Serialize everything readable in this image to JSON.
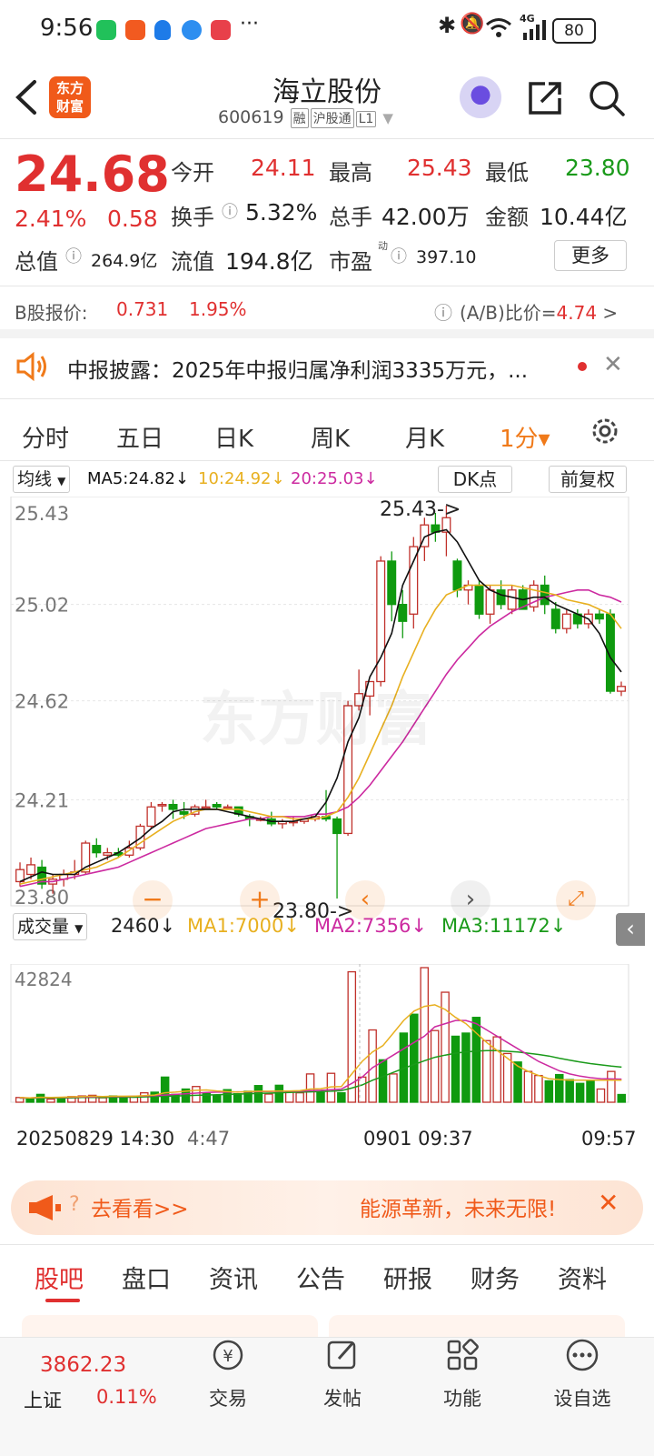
{
  "status_bar": {
    "time": "9:56",
    "network": "4G",
    "battery": "80"
  },
  "header": {
    "logo_text": "东方\n财富",
    "title": "海立股份",
    "code": "600619",
    "tags": [
      "融",
      "沪股通",
      "L1"
    ]
  },
  "quote": {
    "price": "24.68",
    "change_pct": "2.41%",
    "change": "0.58",
    "open_label": "今开",
    "open": "24.11",
    "high_label": "最高",
    "high": "25.43",
    "low_label": "最低",
    "low": "23.80",
    "turnover_label": "换手",
    "turnover": "5.32%",
    "volume_label": "总手",
    "volume": "42.00万",
    "amount_label": "金额",
    "amount": "10.44亿",
    "mcap_label": "总值",
    "mcap": "264.9亿",
    "float_label": "流值",
    "float": "194.8亿",
    "pe_label": "市盈",
    "pe_sup": "动",
    "pe": "397.10",
    "more_button": "更多",
    "b_share_label": "B股报价:",
    "b_share_price": "0.731",
    "b_share_pct": "1.95%",
    "ab_ratio_label": "(A/B)比价=",
    "ab_ratio": "4.74",
    "ab_arrow": ">"
  },
  "notice": {
    "text": "中报披露：2025年中报归属净利润3335万元，..."
  },
  "chart_tabs": [
    "分时",
    "五日",
    "日K",
    "周K",
    "月K",
    "1分▾"
  ],
  "chart_controls": {
    "indicator": "均线",
    "ma5": "MA5:24.82↓",
    "ma10": "10:24.92↓",
    "ma20": "20:25.03↓",
    "dk": "DK点",
    "adjust": "前复权"
  },
  "volume_controls": {
    "indicator": "成交量",
    "vol": "2460↓",
    "ma1": "MA1:7000↓",
    "ma2": "MA2:7356↓",
    "ma3": "MA3:11172↓"
  },
  "annotations": {
    "high": "25.43->",
    "low": "23.80->"
  },
  "watermark": "东方财富",
  "x_labels": [
    "20250829 14:30",
    "4:47",
    "0901 09:37",
    "09:57"
  ],
  "promo": {
    "left": "去看看>>",
    "right": "能源革新，未来无限!"
  },
  "bottom_tabs": [
    "股吧",
    "盘口",
    "资讯",
    "公告",
    "研报",
    "财务",
    "资料"
  ],
  "bottom_nav": {
    "index_value": "3862.23",
    "index_name": "上证",
    "index_pct": "0.11%",
    "items": [
      "交易",
      "发帖",
      "功能",
      "设自选"
    ]
  },
  "colors": {
    "up": "#e03030",
    "down": "#1a9a1a",
    "accent": "#f07a1a",
    "ma5": "#111111",
    "ma10": "#e8b020",
    "ma20": "#cc2aa0"
  },
  "chart_data": [
    {
      "type": "candlestick",
      "title": "",
      "ylim": [
        23.8,
        25.43
      ],
      "y_ticks": [
        "25.43",
        "25.02",
        "24.62",
        "24.21",
        "23.80"
      ],
      "x_ticks": [
        "20250829 14:30",
        "4:47",
        "0901 09:37",
        "09:57"
      ],
      "ohlc": [
        [
          23.87,
          23.95,
          23.85,
          23.92
        ],
        [
          23.9,
          23.97,
          23.88,
          23.94
        ],
        [
          23.93,
          23.96,
          23.84,
          23.86
        ],
        [
          23.86,
          23.9,
          23.82,
          23.88
        ],
        [
          23.88,
          23.92,
          23.85,
          23.9
        ],
        [
          23.9,
          23.96,
          23.88,
          23.91
        ],
        [
          23.91,
          24.04,
          23.9,
          24.03
        ],
        [
          24.02,
          24.05,
          23.97,
          23.99
        ],
        [
          23.98,
          24.01,
          23.96,
          23.99
        ],
        [
          23.99,
          24.01,
          23.97,
          23.98
        ],
        [
          23.98,
          24.04,
          23.97,
          24.01
        ],
        [
          24.01,
          24.11,
          24.0,
          24.1
        ],
        [
          24.1,
          24.2,
          24.09,
          24.18
        ],
        [
          24.19,
          24.2,
          24.16,
          24.19
        ],
        [
          24.19,
          24.21,
          24.13,
          24.17
        ],
        [
          24.16,
          24.2,
          24.13,
          24.15
        ],
        [
          24.15,
          24.19,
          24.14,
          24.18
        ],
        [
          24.18,
          24.21,
          24.17,
          24.18
        ],
        [
          24.19,
          24.2,
          24.17,
          24.18
        ],
        [
          24.18,
          24.19,
          24.17,
          24.18
        ],
        [
          24.18,
          24.18,
          24.14,
          24.15
        ],
        [
          24.14,
          24.15,
          24.1,
          24.13
        ],
        [
          24.13,
          24.14,
          24.12,
          24.13
        ],
        [
          24.13,
          24.16,
          24.1,
          24.11
        ],
        [
          24.11,
          24.13,
          24.09,
          24.12
        ],
        [
          24.12,
          24.14,
          24.1,
          24.12
        ],
        [
          24.12,
          24.13,
          24.11,
          24.13
        ],
        [
          24.13,
          24.14,
          24.12,
          24.14
        ],
        [
          24.14,
          24.25,
          24.12,
          24.13
        ],
        [
          24.13,
          24.14,
          23.8,
          24.07
        ],
        [
          24.07,
          24.62,
          24.06,
          24.6
        ],
        [
          24.6,
          24.75,
          24.58,
          24.65
        ],
        [
          24.64,
          24.7,
          24.56,
          24.7
        ],
        [
          24.7,
          25.22,
          24.68,
          25.2
        ],
        [
          25.2,
          25.24,
          24.95,
          25.02
        ],
        [
          25.02,
          25.08,
          24.88,
          24.95
        ],
        [
          24.98,
          25.3,
          24.92,
          25.26
        ],
        [
          25.26,
          25.38,
          25.2,
          25.35
        ],
        [
          25.35,
          25.4,
          25.28,
          25.32
        ],
        [
          25.32,
          25.43,
          25.22,
          25.38
        ],
        [
          25.2,
          25.21,
          25.05,
          25.08
        ],
        [
          25.08,
          25.12,
          25.02,
          25.1
        ],
        [
          25.1,
          25.12,
          24.96,
          24.98
        ],
        [
          24.98,
          25.1,
          24.94,
          25.08
        ],
        [
          25.08,
          25.12,
          25.0,
          25.02
        ],
        [
          25.0,
          25.1,
          24.98,
          25.08
        ],
        [
          25.08,
          25.1,
          25.0,
          25.0
        ],
        [
          25.01,
          25.12,
          24.99,
          25.1
        ],
        [
          25.1,
          25.14,
          24.98,
          25.02
        ],
        [
          25.0,
          25.03,
          24.9,
          24.92
        ],
        [
          24.92,
          25.0,
          24.9,
          24.98
        ],
        [
          24.98,
          25.0,
          24.92,
          24.94
        ],
        [
          24.94,
          25.0,
          24.92,
          24.98
        ],
        [
          24.98,
          25.0,
          24.94,
          24.96
        ],
        [
          24.98,
          25.0,
          24.65,
          24.66
        ],
        [
          24.66,
          24.7,
          24.64,
          24.68
        ]
      ],
      "ma5": [
        23.87,
        23.89,
        23.91,
        23.9,
        23.9,
        23.9,
        23.93,
        23.95,
        23.97,
        23.99,
        24.02,
        24.05,
        24.09,
        24.12,
        24.16,
        24.17,
        24.17,
        24.17,
        24.17,
        24.16,
        24.15,
        24.14,
        24.13,
        24.12,
        24.12,
        24.12,
        24.13,
        24.14,
        24.2,
        24.3,
        24.45,
        24.55,
        24.72,
        24.8,
        24.9,
        25.1,
        25.2,
        25.3,
        25.32,
        25.33,
        25.28,
        25.2,
        25.12,
        25.08,
        25.06,
        25.05,
        25.04,
        25.05,
        25.05,
        25.02,
        25.0,
        24.98,
        24.96,
        24.9,
        24.8,
        24.74
      ],
      "ma10": [
        23.86,
        23.87,
        23.88,
        23.89,
        23.9,
        23.91,
        23.92,
        23.93,
        23.95,
        23.97,
        24.0,
        24.03,
        24.06,
        24.09,
        24.12,
        24.14,
        24.16,
        24.17,
        24.17,
        24.17,
        24.17,
        24.16,
        24.15,
        24.14,
        24.14,
        24.13,
        24.13,
        24.13,
        24.14,
        24.16,
        24.22,
        24.3,
        24.4,
        24.5,
        24.6,
        24.72,
        24.82,
        24.92,
        25.0,
        25.06,
        25.08,
        25.1,
        25.1,
        25.1,
        25.1,
        25.1,
        25.09,
        25.08,
        25.07,
        25.06,
        25.04,
        25.03,
        25.02,
        25.0,
        24.98,
        24.92
      ],
      "ma20": [
        23.85,
        23.86,
        23.87,
        23.87,
        23.88,
        23.89,
        23.9,
        23.91,
        23.92,
        23.93,
        23.95,
        23.97,
        23.99,
        24.01,
        24.03,
        24.05,
        24.07,
        24.09,
        24.1,
        24.11,
        24.12,
        24.13,
        24.13,
        24.14,
        24.14,
        24.14,
        24.14,
        24.15,
        24.15,
        24.16,
        24.18,
        24.22,
        24.27,
        24.33,
        24.39,
        24.45,
        24.52,
        24.59,
        24.66,
        24.73,
        24.79,
        24.84,
        24.89,
        24.93,
        24.96,
        24.99,
        25.01,
        25.03,
        25.05,
        25.06,
        25.07,
        25.08,
        25.08,
        25.06,
        25.05,
        25.03
      ]
    },
    {
      "type": "bar",
      "title": "成交量",
      "ylim": [
        0,
        42824
      ],
      "y_ticks": [
        "42824"
      ],
      "values": [
        1500,
        1200,
        2500,
        1000,
        1500,
        1800,
        2000,
        2200,
        1400,
        2000,
        1800,
        1600,
        3000,
        3200,
        8000,
        2500,
        4200,
        5000,
        2800,
        2200,
        4000,
        2700,
        3500,
        5300,
        2600,
        5400,
        3200,
        3000,
        9000,
        3100,
        9200,
        3000,
        41500,
        8000,
        23000,
        13500,
        9000,
        22000,
        28000,
        42824,
        22800,
        35000,
        21000,
        22000,
        27000,
        19600,
        20800,
        15500,
        12800,
        9800,
        8500,
        6800,
        8800,
        7200,
        6000,
        6800,
        4200,
        9800,
        2460
      ],
      "ma1": [
        1500,
        1400,
        1600,
        1500,
        1600,
        1700,
        1800,
        1900,
        1800,
        1900,
        1900,
        1900,
        2100,
        2300,
        3000,
        3200,
        3500,
        3800,
        3900,
        3600,
        3400,
        3200,
        3400,
        3500,
        3500,
        3600,
        3600,
        3700,
        4200,
        4300,
        4900,
        5000,
        9000,
        13000,
        16000,
        18000,
        22000,
        26000,
        29000,
        30500,
        31000,
        29500,
        27000,
        25000,
        22000,
        19000,
        16500,
        14000,
        11500,
        9800,
        8500,
        7500,
        7200,
        7000,
        7000,
        7000,
        7000,
        7000,
        7000
      ],
      "ma2": [
        1400,
        1400,
        1500,
        1500,
        1500,
        1600,
        1700,
        1700,
        1800,
        1800,
        1800,
        1900,
        2000,
        2100,
        2300,
        2500,
        2700,
        2900,
        3100,
        3200,
        3200,
        3300,
        3300,
        3400,
        3400,
        3500,
        3500,
        3500,
        3700,
        3800,
        4000,
        4200,
        6000,
        8000,
        11000,
        13000,
        15000,
        17000,
        19000,
        21000,
        24000,
        25000,
        26000,
        26000,
        25000,
        23000,
        21000,
        19000,
        17000,
        15000,
        13000,
        11500,
        10000,
        9000,
        8300,
        7800,
        7500,
        7400,
        7356
      ],
      "ma3": [
        1300,
        1300,
        1300,
        1400,
        1400,
        1400,
        1500,
        1500,
        1500,
        1600,
        1600,
        1600,
        1700,
        1800,
        1900,
        2000,
        2100,
        2200,
        2300,
        2400,
        2500,
        2600,
        2700,
        2800,
        2900,
        3000,
        3100,
        3200,
        3300,
        3400,
        3500,
        3700,
        4500,
        5500,
        7000,
        8200,
        9500,
        10800,
        12000,
        13200,
        14300,
        15000,
        15600,
        16000,
        16300,
        16400,
        16400,
        16200,
        16000,
        15600,
        15200,
        14700,
        14000,
        13400,
        12800,
        12300,
        11900,
        11500,
        11172
      ]
    }
  ]
}
